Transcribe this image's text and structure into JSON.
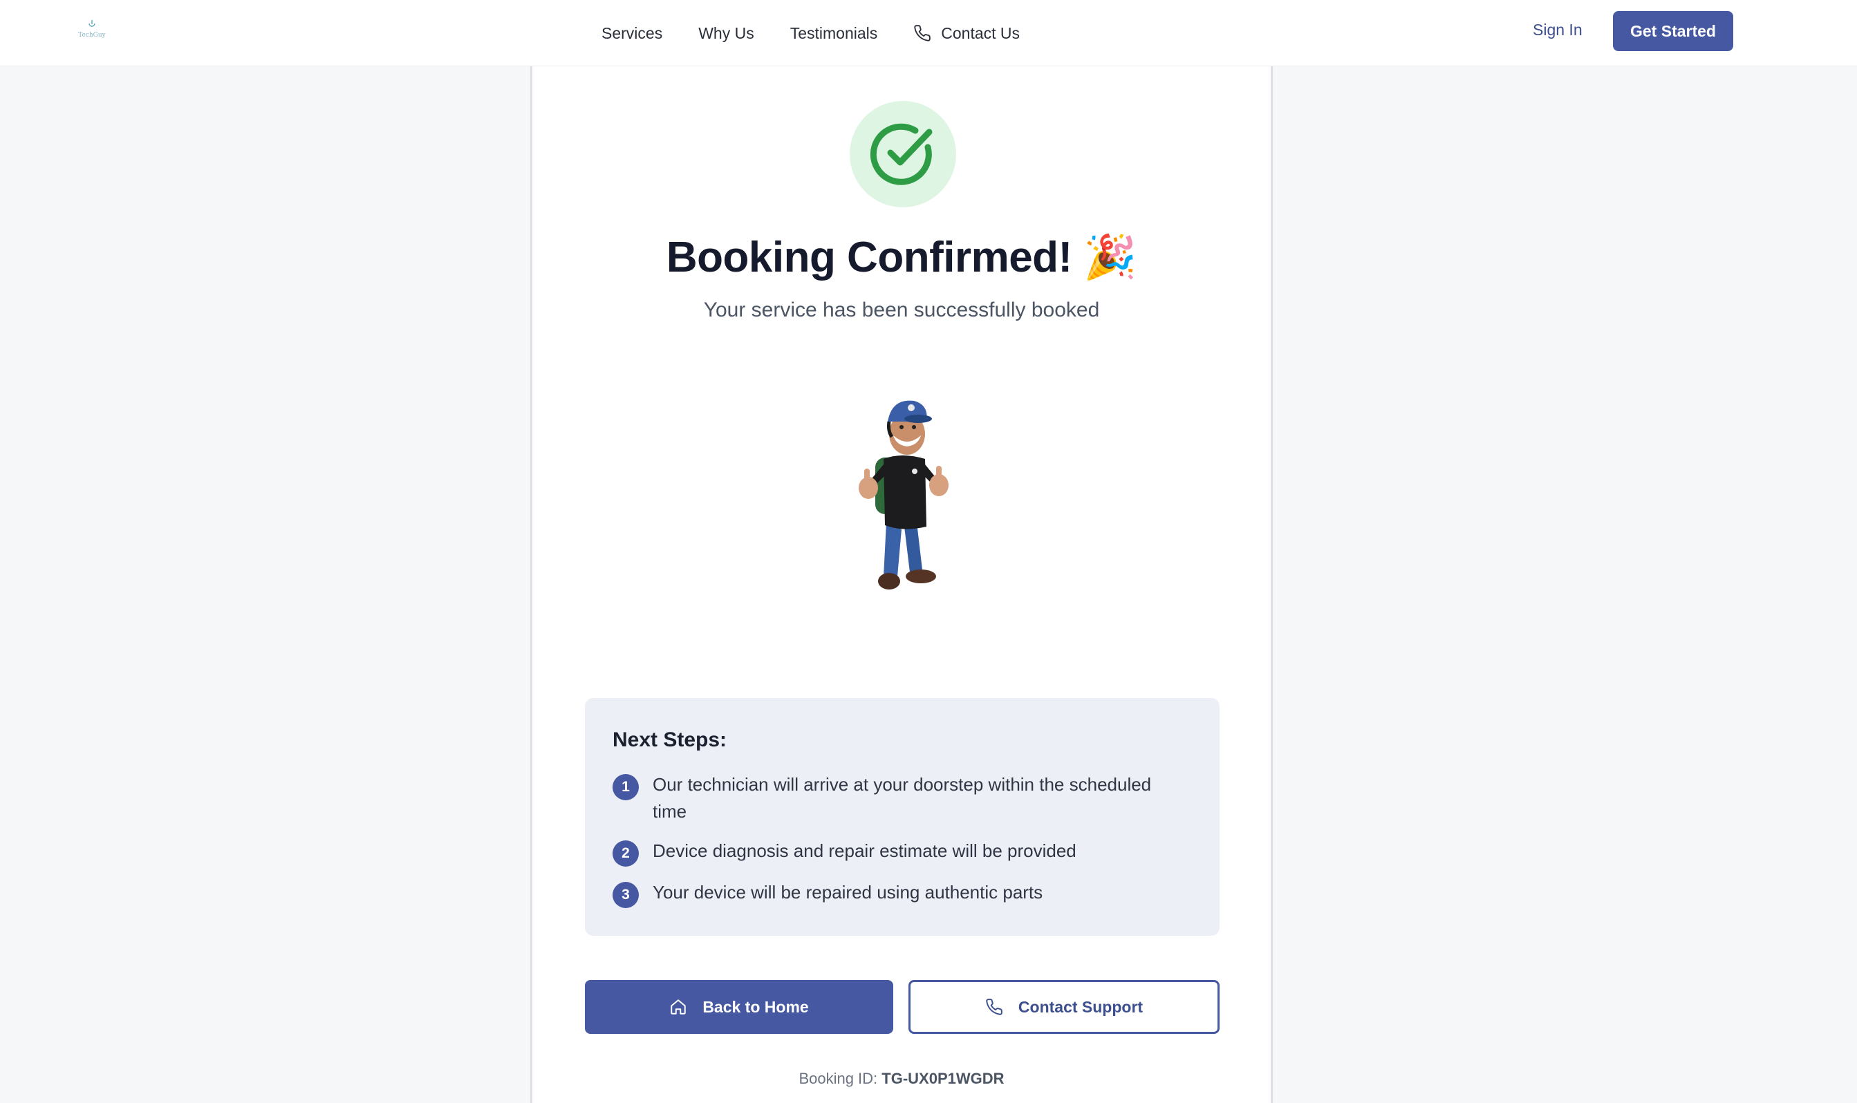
{
  "header": {
    "logo_text": "TechGuy",
    "nav": [
      {
        "label": "Services"
      },
      {
        "label": "Why Us"
      },
      {
        "label": "Testimonials"
      },
      {
        "label": "Contact Us",
        "icon": "phone-icon"
      }
    ],
    "sign_in": "Sign In",
    "get_started": "Get Started"
  },
  "confirmation": {
    "icon": "check-circle-icon",
    "title": "Booking Confirmed! 🎉",
    "subtitle": "Your service has been successfully booked",
    "illustration": "technician-mascot"
  },
  "next_steps": {
    "title": "Next Steps:",
    "items": [
      {
        "number": "1",
        "text": "Our technician will arrive at your doorstep within the scheduled time"
      },
      {
        "number": "2",
        "text": "Device diagnosis and repair estimate will be provided"
      },
      {
        "number": "3",
        "text": "Your device will be repaired using authentic parts"
      }
    ]
  },
  "actions": {
    "back_home": "Back to Home",
    "contact_support": "Contact Support"
  },
  "booking": {
    "label": "Booking ID:",
    "id": "TG-UX0P1WGDR"
  },
  "colors": {
    "primary": "#4658a2",
    "success": "#2e9b45",
    "success_bg": "#dff5e3",
    "steps_bg": "#edeff7"
  }
}
